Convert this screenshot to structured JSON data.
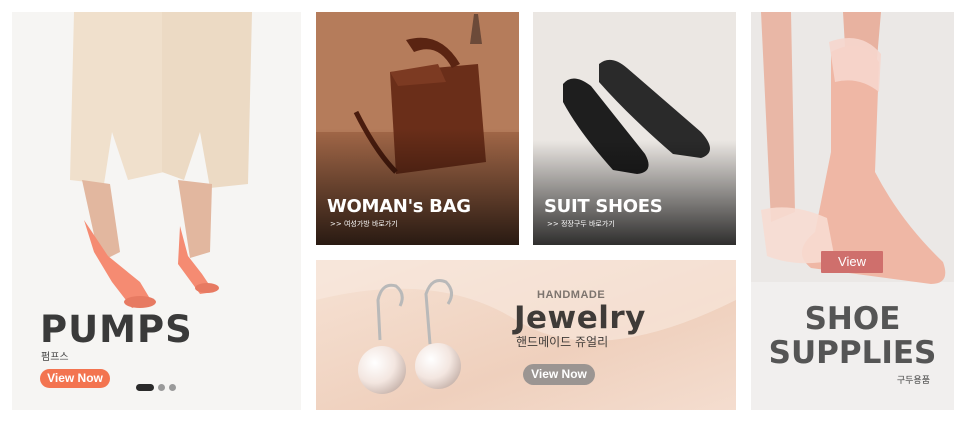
{
  "pumps": {
    "title": "PUMPS",
    "subtitle": "펌프스",
    "button": "View Now",
    "carousel_dots": 3,
    "active_dot": 0
  },
  "bag": {
    "title": "WOMAN's BAG",
    "subtitle": ">> 여성가방 바로가기"
  },
  "suit": {
    "title": "SUIT SHOES",
    "subtitle": ">> 정장구두 바로가기"
  },
  "jewelry": {
    "eyebrow": "HANDMADE",
    "title": "Jewelry",
    "subtitle": "핸드메이드 쥬얼리",
    "button": "View Now"
  },
  "supplies": {
    "button": "View",
    "title_line1": "SHOE",
    "title_line2": "SUPPLIES",
    "subtitle": "구두용품"
  },
  "colors": {
    "accent_orange": "#f37450",
    "view_pink": "#cf6f6c",
    "jewelry_button": "#9b9592"
  }
}
